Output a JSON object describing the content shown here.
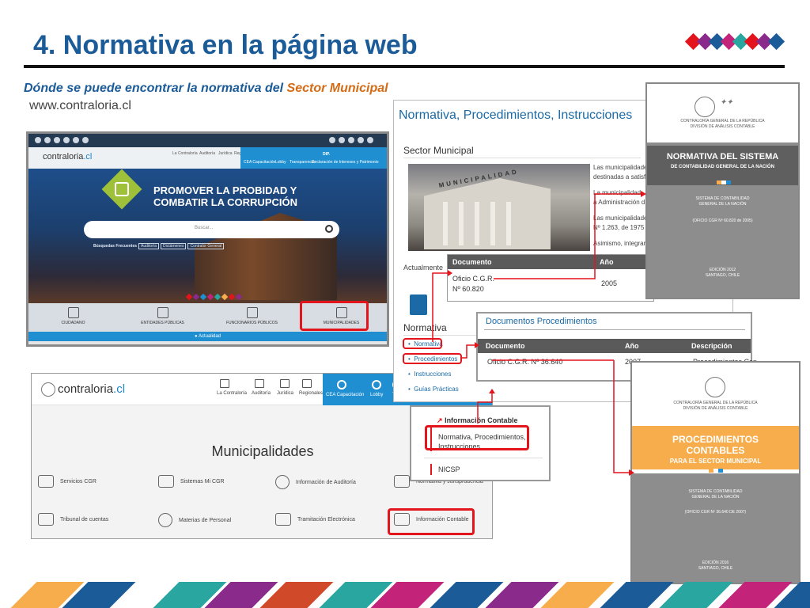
{
  "slide": {
    "title": "4. Normativa en la página web",
    "subtitle_prefix": "Dónde se puede encontrar la normativa del ",
    "subtitle_highlight": "Sector Municipal",
    "url": "www.contraloria.cl",
    "accent_colors": [
      "#e3141b",
      "#1b5b98",
      "#d46b16"
    ]
  },
  "home_screenshot": {
    "logo_prefix": "contraloria",
    "logo_suffix": ".cl",
    "nav": [
      "La Contraloría",
      "Auditoría",
      "Jurídica",
      "Regionales"
    ],
    "nav_blue": [
      "CEA Capacitación",
      "Lobby",
      "Transparencia",
      "Declaración de Intereses y Patrimonio"
    ],
    "dip": "DIP.",
    "promo_line1": "PROMOVER LA PROBIDAD Y",
    "promo_line2": "COMBATIR LA CORRUPCIÓN",
    "search_placeholder": "Buscar...",
    "frequent_label": "Búsquedas Frecuentes",
    "frequent": [
      "Auditoría",
      "Dictámenes",
      "Contralor General"
    ],
    "categories": [
      "CIUDADANO",
      "ENTIDADES PÚBLICAS",
      "FUNCIONARIOS PÚBLICOS",
      "MUNICIPALIDADES"
    ],
    "actualidad": "Actualidad"
  },
  "municipal_screenshot": {
    "logo_prefix": "contraloria",
    "logo_suffix": ".cl",
    "nav": [
      "La Contraloría",
      "Auditoría",
      "Jurídica",
      "Regionales"
    ],
    "nav_blue": [
      "CEA Capacitación",
      "Lobby",
      "Tr"
    ],
    "page_title": "Municipalidades",
    "items": [
      "Servicios CGR",
      "Sistemas Mi CGR",
      "Información de Auditoría",
      "Normativa y Jurisprudencia",
      "Tribunal de cuentas",
      "Materias de Personal",
      "Tramitación Electrónica",
      "Información Contable"
    ]
  },
  "sector_page": {
    "heading": "Normativa, Procedimientos, Instrucciones",
    "section": "Sector Municipal",
    "photo_sign": "MUNICIPALIDAD",
    "text_lines": [
      "Las municipalidade",
      "destinadas a satisfa",
      "La municipalidad",
      "a Administración d",
      "Las municipalidade",
      "Nº 1.263, de 1975",
      "Asimismo, integrar"
    ],
    "actualmente": "Actualmente",
    "normativa_heading": "Normativa",
    "links": [
      "Normativa",
      "Procedimientos",
      "Instrucciones",
      "Guías Prácticas"
    ]
  },
  "documento_table": {
    "col_documento": "Documento",
    "col_anio": "Año",
    "doc_line1": "Oficio C.G.R.",
    "doc_line2": "Nº 60.820",
    "year": "2005"
  },
  "procedimientos_table": {
    "heading": "Documentos Procedimientos",
    "col_documento": "Documento",
    "col_anio": "Año",
    "col_descripcion": "Descripción",
    "doc": "Oficio C.G.R. Nº 36.640",
    "year": "2007",
    "desc": "Procedimientos Con"
  },
  "info_contable_popup": {
    "title": "Información Contable",
    "item1_line1": "Normativa, Procedimientos,",
    "item1_line2": "Instrucciones",
    "item2": "NICSP"
  },
  "cover_normativa": {
    "top_small1": "CONTRALORÍA GENERAL DE LA REPÚBLICA",
    "top_small2": "DIVISIÓN DE ANÁLISIS CONTABLE",
    "title1": "NORMATIVA DEL SISTEMA",
    "title2": "DE CONTABILIDAD GENERAL DE LA NACIÓN",
    "mid1": "SISTEMA DE CONTABILIDAD",
    "mid2": "GENERAL DE LA NACIÓN",
    "oficio": "(OFICIO CGR Nº 60.820 de 2005)",
    "edition1": "EDICIÓN 2012",
    "edition2": "SANTIAGO, CHILE"
  },
  "cover_procedimientos": {
    "top_small1": "CONTRALORÍA GENERAL DE LA REPÚBLICA",
    "top_small2": "DIVISIÓN DE ANÁLISIS CONTABLE",
    "title1": "PROCEDIMIENTOS",
    "title2": "CONTABLES",
    "title3": "PARA EL SECTOR MUNICIPAL",
    "mid1": "SISTEMA DE CONTABILIDAD",
    "mid2": "GENERAL DE LA NACIÓN",
    "oficio": "(OFICIO CGR Nº 36.640 DE 2007)",
    "edition1": "EDICIÓN 2016",
    "edition2": "SANTIAGO, CHILE"
  }
}
